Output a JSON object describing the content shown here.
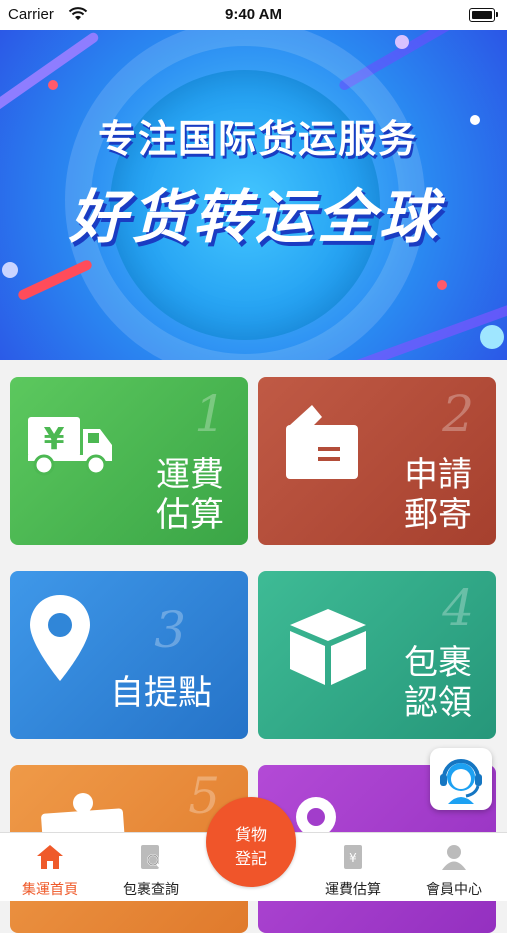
{
  "status_bar": {
    "carrier": "Carrier",
    "time": "9:40 AM"
  },
  "banner": {
    "line1": "专注国际货运服务",
    "line2": "好货转运全球"
  },
  "tiles": [
    {
      "num": "1",
      "label_l1": "運費",
      "label_l2": "估算",
      "icon": "truck-yen-icon"
    },
    {
      "num": "2",
      "label_l1": "申請",
      "label_l2": "郵寄",
      "icon": "package-box-icon"
    },
    {
      "num": "3",
      "label_l1": "自提點",
      "label_l2": "",
      "icon": "location-pin-icon"
    },
    {
      "num": "4",
      "label_l1": "包裹",
      "label_l2": "認領",
      "icon": "cube-icon"
    },
    {
      "num": "5",
      "label_l1": "",
      "label_l2": "",
      "icon": "clipboard-pin-icon"
    },
    {
      "num": "",
      "label_l1": "",
      "label_l2": "",
      "icon": "location-icon"
    }
  ],
  "support": {
    "icon": "customer-service-icon"
  },
  "tabbar": {
    "items": [
      {
        "label": "集運首頁",
        "icon": "home-icon",
        "active": true
      },
      {
        "label": "包裹查詢",
        "icon": "package-search-icon",
        "active": false
      },
      {
        "label": "運費估算",
        "icon": "fee-document-icon",
        "active": false
      },
      {
        "label": "會員中心",
        "icon": "member-icon",
        "active": false
      }
    ],
    "center": {
      "line1": "貨物",
      "line2": "登記"
    }
  },
  "colors": {
    "accent": "#f0552a",
    "tile_green": "#4cb852",
    "tile_red": "#b34d39",
    "tile_blue": "#3086d8",
    "tile_teal": "#33aa88",
    "tile_orange": "#e8893a",
    "tile_purple": "#a23dcb"
  }
}
